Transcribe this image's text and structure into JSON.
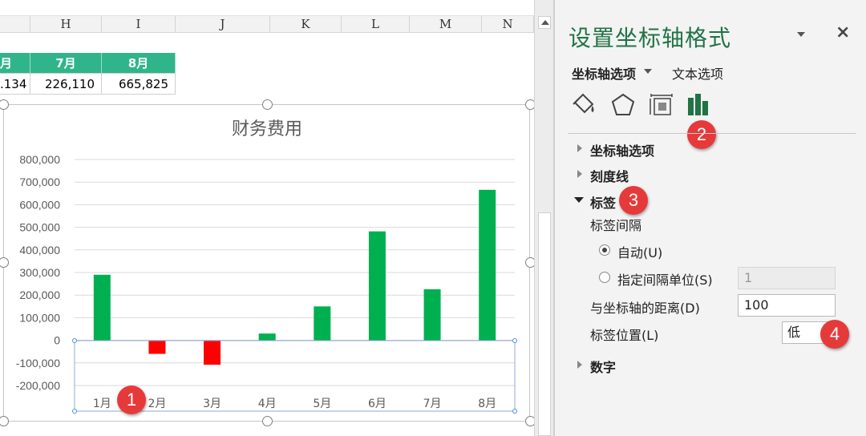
{
  "sheet": {
    "columns": [
      "H",
      "I",
      "J",
      "K",
      "L",
      "M",
      "N"
    ],
    "table": {
      "headers": [
        "月",
        "7月",
        "8月"
      ],
      "values": [
        ".134",
        "226,110",
        "665,825"
      ]
    }
  },
  "chart": {
    "title": "财务费用",
    "colors": {
      "positive": "#00b050",
      "negative": "#ff0000",
      "gridline": "#d9d9d9",
      "axis_text": "#595959"
    }
  },
  "chart_data": {
    "type": "bar",
    "title": "财务费用",
    "categories": [
      "1月",
      "2月",
      "3月",
      "4月",
      "5月",
      "6月",
      "7月",
      "8月"
    ],
    "values": [
      290000,
      -60000,
      -108000,
      30000,
      150000,
      482000,
      226110,
      665825
    ],
    "ylim": [
      -200000,
      800000
    ],
    "yticks": [
      "800,000",
      "700,000",
      "600,000",
      "500,000",
      "400,000",
      "300,000",
      "200,000",
      "100,000",
      "0",
      "-100,000",
      "-200,000"
    ],
    "ytick_values": [
      800000,
      700000,
      600000,
      500000,
      400000,
      300000,
      200000,
      100000,
      0,
      -100000,
      -200000
    ],
    "grid": true,
    "xlabel": "",
    "ylabel": ""
  },
  "panel": {
    "title": "设置坐标轴格式",
    "close": "×",
    "tab_axis_options": "坐标轴选项",
    "tab_text_options": "文本选项",
    "icons": [
      "fill-line-icon",
      "effects-icon",
      "size-properties-icon",
      "axis-options-icon"
    ],
    "sections": {
      "axis_options": "坐标轴选项",
      "tick_marks": "刻度线",
      "labels": "标签",
      "number": "数字"
    },
    "label_interval": "标签间隔",
    "auto": "自动(U)",
    "specify_interval": "指定间隔单位(S)",
    "specify_interval_value": "1",
    "distance_label": "与坐标轴的距离(D)",
    "distance_value": "100",
    "label_position": "标签位置(L)",
    "label_position_value": "低"
  },
  "badges": [
    "1",
    "2",
    "3",
    "4"
  ]
}
